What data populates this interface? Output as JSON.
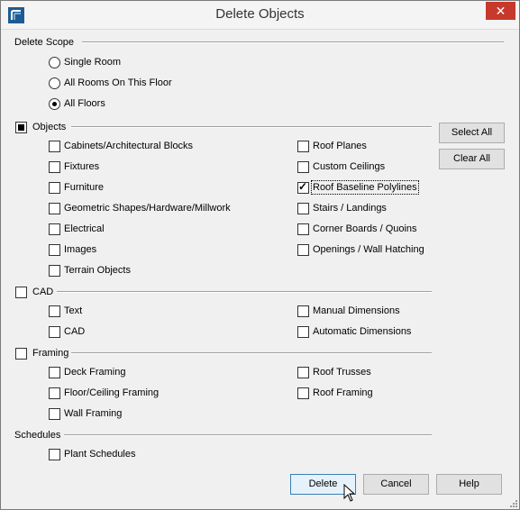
{
  "window": {
    "title": "Delete Objects",
    "close_glyph": "✕"
  },
  "scope": {
    "title": "Delete Scope",
    "options": [
      {
        "label": "Single Room",
        "checked": false
      },
      {
        "label": "All Rooms On This Floor",
        "checked": false
      },
      {
        "label": "All Floors",
        "checked": true
      }
    ]
  },
  "objects": {
    "title": "Objects",
    "left": [
      "Cabinets/Architectural Blocks",
      "Fixtures",
      "Furniture",
      "Geometric Shapes/Hardware/Millwork",
      "Electrical",
      "Images",
      "Terrain Objects"
    ],
    "right": [
      "Roof Planes",
      "Custom Ceilings",
      "Roof Baseline Polylines",
      "Stairs / Landings",
      "Corner Boards / Quoins",
      "Openings / Wall Hatching"
    ],
    "checked_right": "Roof Baseline Polylines"
  },
  "cad": {
    "title": "CAD",
    "left": [
      "Text",
      "CAD"
    ],
    "right": [
      "Manual Dimensions",
      "Automatic Dimensions"
    ]
  },
  "framing": {
    "title": "Framing",
    "left": [
      "Deck Framing",
      "Floor/Ceiling Framing",
      "Wall Framing"
    ],
    "right": [
      "Roof Trusses",
      "Roof Framing"
    ]
  },
  "schedules": {
    "title": "Schedules",
    "items": [
      "Plant Schedules"
    ]
  },
  "buttons": {
    "select_all": "Select All",
    "clear_all": "Clear All",
    "delete": "Delete",
    "cancel": "Cancel",
    "help": "Help"
  }
}
